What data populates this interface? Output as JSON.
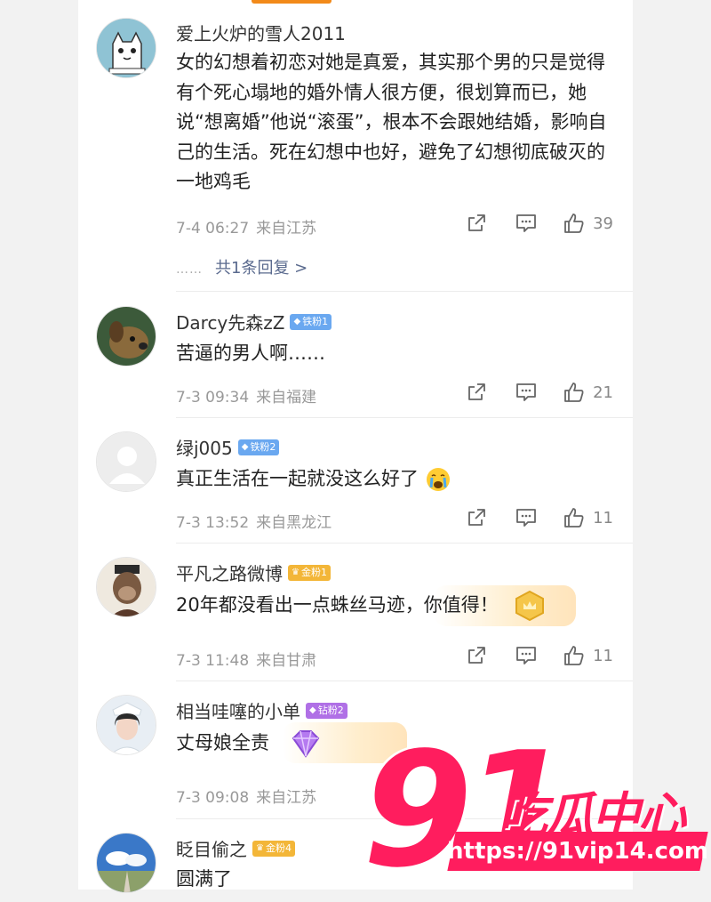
{
  "comments": [
    {
      "user": "爱上火炉的雪人2011",
      "badge": "",
      "text": "女的幻想着初恋对她是真爱，其实那个男的只是觉得有个死心塌地的婚外情人很方便，很划算而已，她说“想离婚”他说“滚蛋”，根本不会跟她结婚，影响自己的生活。死在幻想中也好，避免了幻想彻底破灭的一地鸡毛",
      "time": "7-4 06:27",
      "location": "来自江苏",
      "likes": "39",
      "replies": "共1条回复 >"
    },
    {
      "user": "Darcy先森zZ",
      "badge": "铁粉1",
      "text": "苦逼的男人啊……",
      "time": "7-3 09:34",
      "location": "来自福建",
      "likes": "21"
    },
    {
      "user": "绿j005",
      "badge": "铁粉2",
      "text": "真正生活在一起就没这么好了",
      "time": "7-3 13:52",
      "location": "来自黑龙江",
      "likes": "11"
    },
    {
      "user": "平凡之路微博",
      "badge": "金粉1",
      "text": "20年都没看出一点蛛丝马迹，你值得！",
      "time": "7-3 11:48",
      "location": "来自甘肃",
      "likes": "11"
    },
    {
      "user": "相当哇噻的小单",
      "badge": "钻粉2",
      "text": "丈母娘全责",
      "time": "7-3 09:08",
      "location": "来自江苏",
      "likes": ""
    },
    {
      "user": "眨目偷之",
      "badge": "金粉4",
      "text": "圆满了",
      "time": "",
      "location": "",
      "likes": ""
    }
  ],
  "watermark": {
    "number": "91",
    "name": "吃瓜中心",
    "url": "https://91vip14.com"
  },
  "colors": {
    "accent": "#ff1d5e",
    "link": "#5a6a8e",
    "iron_badge": "#6aa8f0",
    "gold_badge": "#f3b638",
    "diamond_badge": "#b070e6"
  },
  "icons": [
    "share-icon",
    "comment-icon",
    "like-icon"
  ]
}
